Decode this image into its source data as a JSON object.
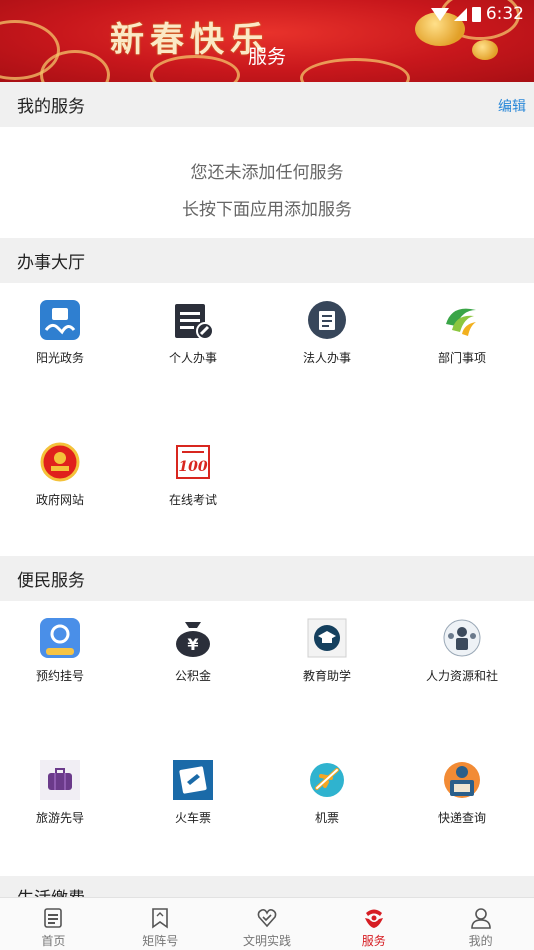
{
  "header": {
    "banner_text": "新春快乐",
    "title": "服务",
    "status_time": "6:32"
  },
  "my_services": {
    "title": "我的服务",
    "edit_label": "编辑",
    "empty_line1": "您还未添加任何服务",
    "empty_line2": "长按下面应用添加服务"
  },
  "office_hall": {
    "title": "办事大厅",
    "items": [
      {
        "label": "阳光政务",
        "icon": "sunshine-affairs-icon"
      },
      {
        "label": "个人办事",
        "icon": "personal-affairs-icon"
      },
      {
        "label": "法人办事",
        "icon": "legal-person-icon"
      },
      {
        "label": "部门事项",
        "icon": "department-icon"
      },
      {
        "label": "政府网站",
        "icon": "national-emblem-icon"
      },
      {
        "label": "在线考试",
        "icon": "exam-icon"
      }
    ]
  },
  "convenience": {
    "title": "便民服务",
    "items": [
      {
        "label": "预约挂号",
        "icon": "registration-icon"
      },
      {
        "label": "公积金",
        "icon": "provident-fund-icon"
      },
      {
        "label": "教育助学",
        "icon": "education-icon"
      },
      {
        "label": "人力资源和社",
        "icon": "human-resources-icon"
      },
      {
        "label": "旅游先导",
        "icon": "suitcase-icon"
      },
      {
        "label": "火车票",
        "icon": "train-ticket-icon"
      },
      {
        "label": "机票",
        "icon": "airplane-icon"
      },
      {
        "label": "快递查询",
        "icon": "courier-icon"
      }
    ]
  },
  "next_section_peek": "生活缴费",
  "bottom_nav": [
    {
      "label": "首页",
      "icon": "home-icon"
    },
    {
      "label": "矩阵号",
      "icon": "bookmark-icon"
    },
    {
      "label": "文明实践",
      "icon": "heart-icon"
    },
    {
      "label": "服务",
      "icon": "service-icon",
      "active": true
    },
    {
      "label": "我的",
      "icon": "profile-icon"
    }
  ],
  "colors": {
    "accent_red": "#d61d23",
    "link_blue": "#2a88d8",
    "section_bg": "#f0f0f0"
  }
}
